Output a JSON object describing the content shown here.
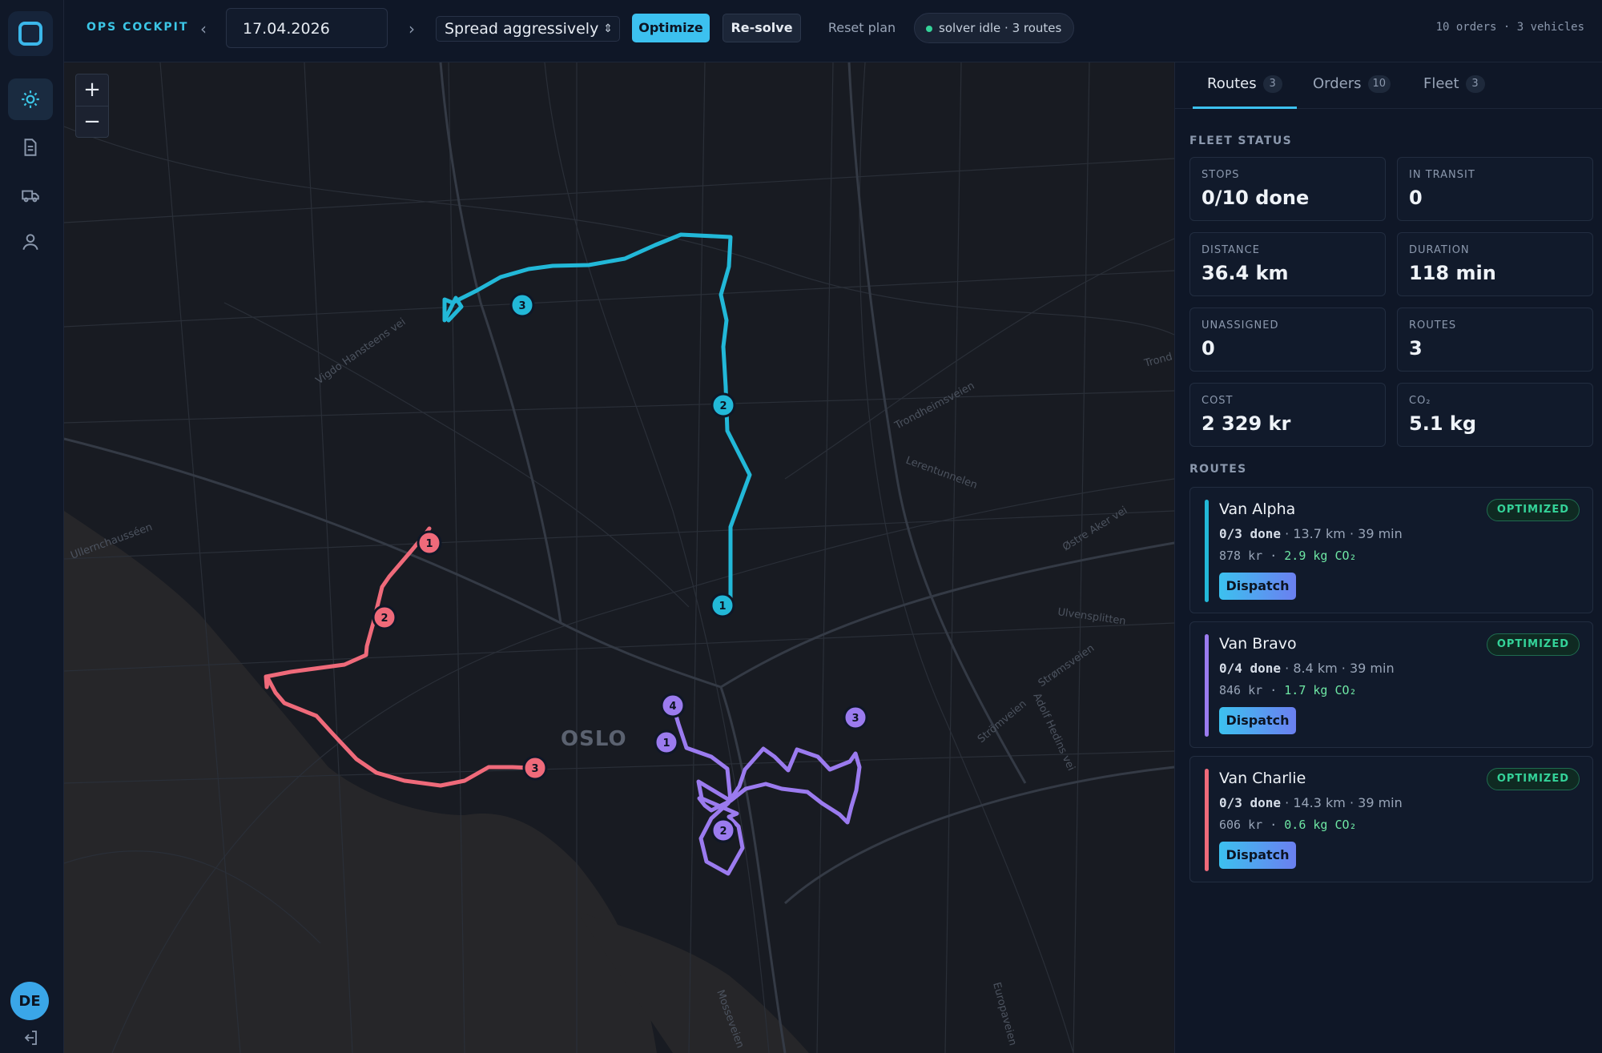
{
  "app": {
    "brand": "OPS COCKPIT",
    "date": "17.04.2026",
    "strategy": "Spread aggressively",
    "optimize_label": "Optimize",
    "resolve_label": "Re-solve",
    "reset_label": "Reset plan",
    "solver_status": "solver idle · 3 routes",
    "summary": "10 orders · 3 vehicles",
    "user_initials": "DE",
    "prev_arrow": "‹",
    "next_arrow": "›"
  },
  "map": {
    "city_label": "OSLO",
    "zoom_in": "+",
    "zoom_out": "−",
    "streets": [
      "Ullernchausséen",
      "Vigdo Hansteens vei",
      "Trondheimsveien",
      "Lerentunnelen",
      "Østre Aker vei",
      "Ulvensplitten",
      "Strømsveien",
      "Adolf Hedins vei",
      "Mosseveien",
      "Europaveien",
      "Strömveien",
      "Trond"
    ]
  },
  "tabs": [
    {
      "label": "Routes",
      "count": "3"
    },
    {
      "label": "Orders",
      "count": "10"
    },
    {
      "label": "Fleet",
      "count": "3"
    }
  ],
  "fleet": {
    "section_title": "FLEET STATUS",
    "stats": [
      {
        "label": "STOPS",
        "value": "0/10 done"
      },
      {
        "label": "IN TRANSIT",
        "value": "0"
      },
      {
        "label": "DISTANCE",
        "value": "36.4 km"
      },
      {
        "label": "DURATION",
        "value": "118 min"
      },
      {
        "label": "UNASSIGNED",
        "value": "0"
      },
      {
        "label": "ROUTES",
        "value": "3"
      },
      {
        "label": "COST",
        "value": "2 329 kr"
      },
      {
        "label": "CO₂",
        "value": "5.1 kg"
      }
    ]
  },
  "routes": {
    "section_title": "ROUTES",
    "items": [
      {
        "name": "Van Alpha",
        "status": "OPTIMIZED",
        "done": "0/3 done",
        "meta": " · 13.7 km · 39 min",
        "cost": "878 kr",
        "co2": "2.9 kg CO₂",
        "dispatch": "Dispatch",
        "color": "#22b8d8"
      },
      {
        "name": "Van Bravo",
        "status": "OPTIMIZED",
        "done": "0/4 done",
        "meta": " · 8.4 km · 39 min",
        "cost": "846 kr",
        "co2": "1.7 kg CO₂",
        "dispatch": "Dispatch",
        "color": "#9b7bef"
      },
      {
        "name": "Van Charlie",
        "status": "OPTIMIZED",
        "done": "0/3 done",
        "meta": " · 14.3 km · 39 min",
        "cost": "606 kr",
        "co2": "0.6 kg CO₂",
        "dispatch": "Dispatch",
        "color": "#ef6a7a"
      }
    ]
  },
  "stop_labels": {
    "alpha": [
      "1",
      "2",
      "3"
    ],
    "bravo": [
      "1",
      "2",
      "3",
      "4"
    ],
    "charlie": [
      "1",
      "2",
      "3"
    ]
  },
  "colors": {
    "accent": "#3cc1ef",
    "alpha": "#22b8d8",
    "bravo": "#9b7bef",
    "charlie": "#ef6a7a",
    "optimized": "#34d399"
  }
}
